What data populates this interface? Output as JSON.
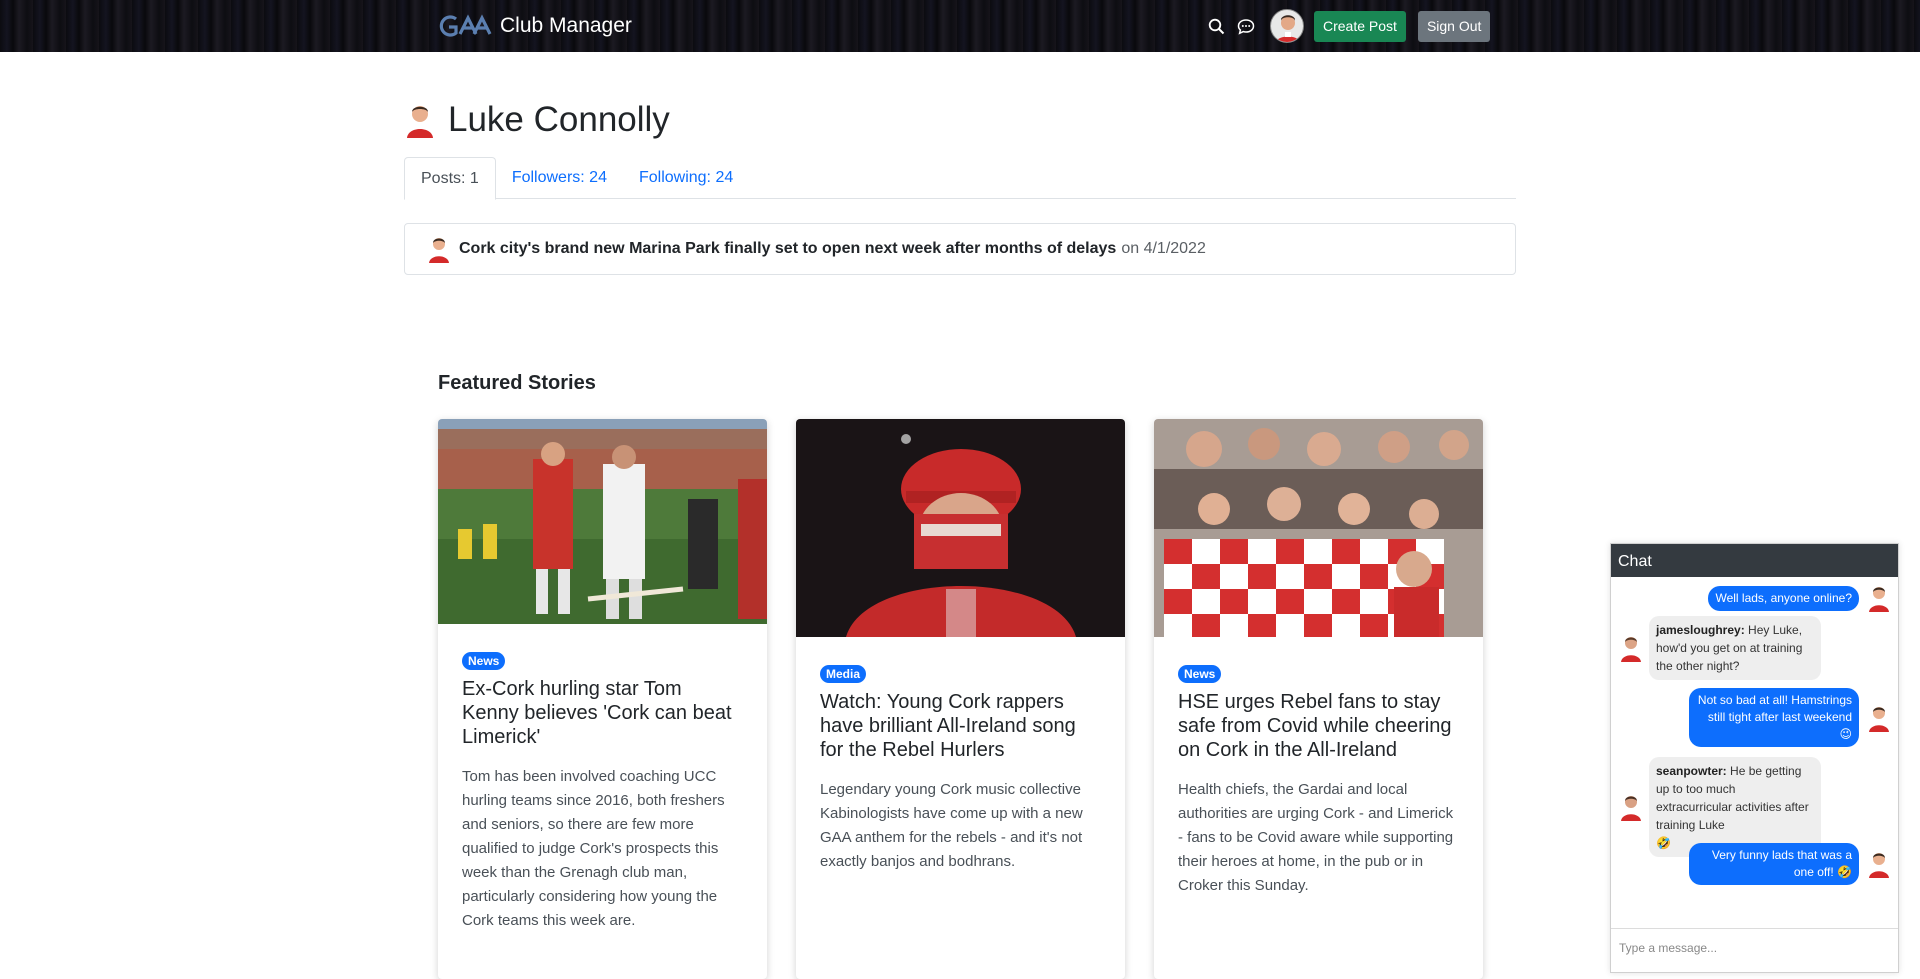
{
  "header": {
    "app_name": "Club Manager",
    "logo_icon": "gaa-logo",
    "search_icon": "search-icon",
    "messages_icon": "chat-bubble-icon",
    "create_post_label": "Create Post",
    "sign_out_label": "Sign Out",
    "colors": {
      "create_post": "#198754",
      "sign_out": "#6c757d"
    }
  },
  "profile": {
    "name": "Luke Connolly",
    "tabs": [
      {
        "label": "Posts: 1",
        "active": true
      },
      {
        "label": "Followers: 24",
        "active": false
      },
      {
        "label": "Following: 24",
        "active": false
      }
    ],
    "posts": [
      {
        "title": "Cork city's brand new Marina Park finally set to open next week after months of delays",
        "meta": "on 4/1/2022"
      }
    ]
  },
  "featured": {
    "heading": "Featured Stories",
    "cards": [
      {
        "badge": "News",
        "title": "Ex-Cork hurling star Tom Kenny believes 'Cork can beat Limerick'",
        "text": "Tom has been involved coaching UCC hurling teams since 2016, both freshers and seniors, so there are few more qualified to judge Cork's prospects this week than the Grenagh club man, particularly considering how young the Cork teams this week are."
      },
      {
        "badge": "Media",
        "title": "Watch: Young Cork rappers have brilliant All-Ireland song for the Rebel Hurlers",
        "text": "Legendary young Cork music collective Kabinologists have come up with a new GAA anthem for the rebels - and it's not exactly banjos and bodhrans."
      },
      {
        "badge": "News",
        "title": "HSE urges Rebel fans to stay safe from Covid while cheering on Cork in the All-Ireland",
        "text": "Health chiefs, the Gardai and local authorities are urging Cork - and Limerick - fans to be Covid aware while supporting their heroes at home, in the pub or in Croker this Sunday."
      }
    ]
  },
  "chat": {
    "title": "Chat",
    "messages": [
      {
        "direction": "out",
        "text": "Well lads, anyone online?"
      },
      {
        "direction": "in",
        "user": "jamesloughrey:",
        "text": " Hey Luke, how'd you get on at training the other night?"
      },
      {
        "direction": "out",
        "text": "Not so bad at all! Hamstrings still tight after last weekend",
        "emoji": "😉"
      },
      {
        "direction": "in",
        "user": "seanpowter:",
        "text": " He be getting up to too much extracurricular activities after training Luke",
        "emoji": "🤣"
      },
      {
        "direction": "out",
        "text": "Very funny lads that was a one off!",
        "emoji": "🤣"
      }
    ],
    "input_placeholder": "Type a message..."
  }
}
